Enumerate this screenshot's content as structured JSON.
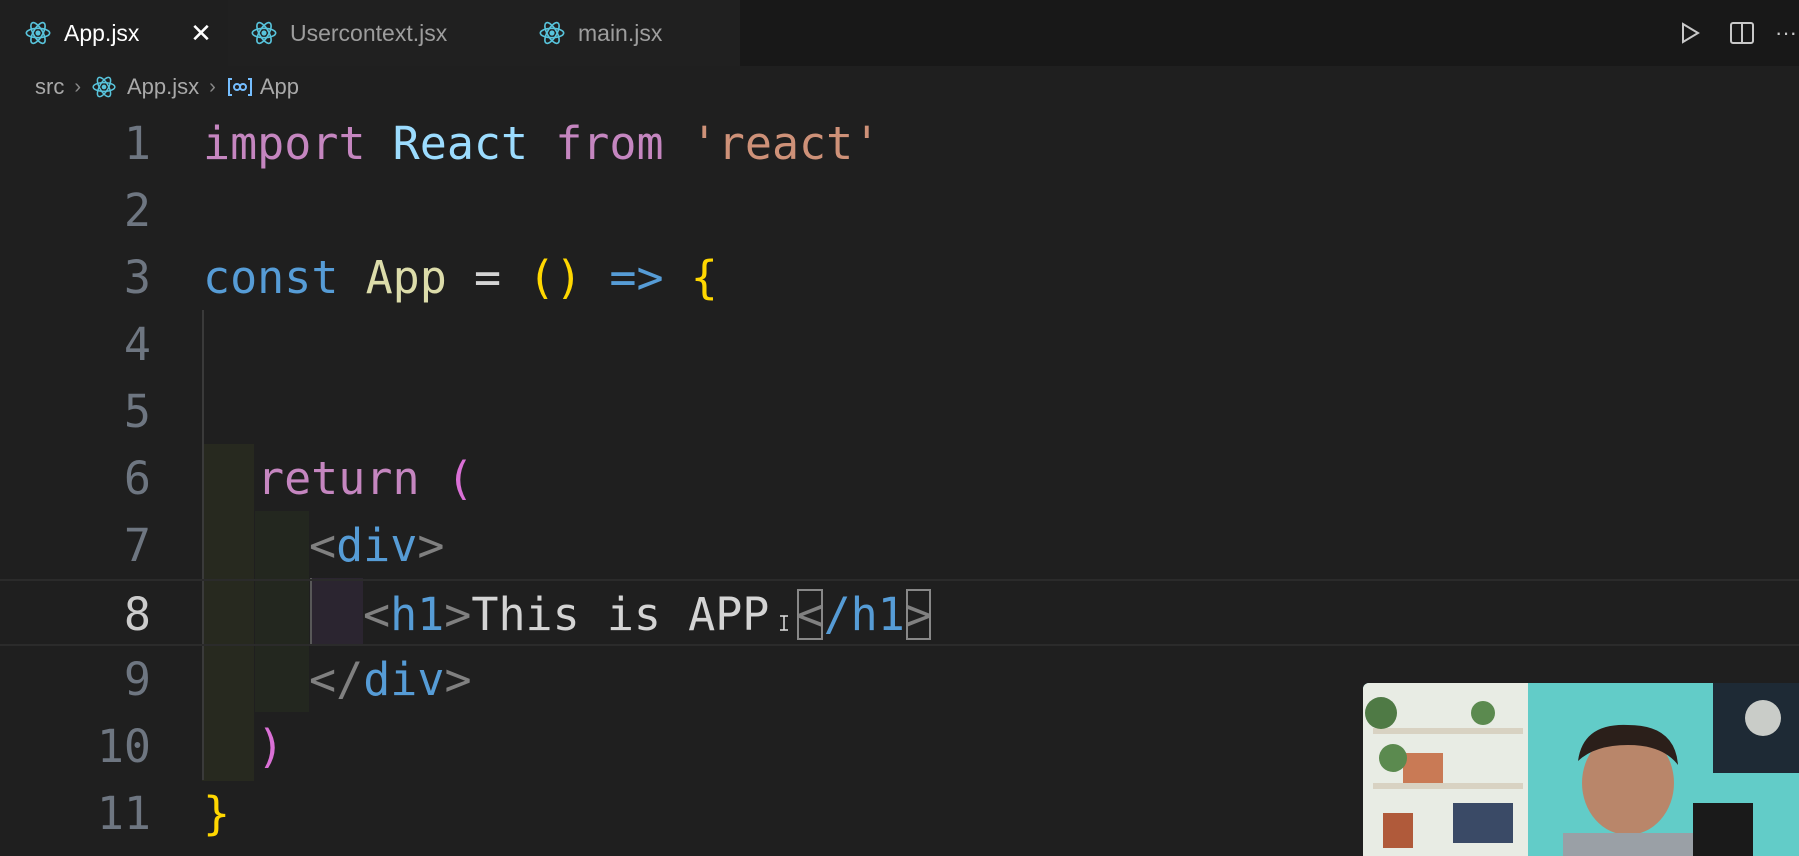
{
  "tabs": [
    {
      "label": "App.jsx",
      "active": true
    },
    {
      "label": "Usercontext.jsx",
      "active": false
    },
    {
      "label": "main.jsx",
      "active": false
    }
  ],
  "tab_close_glyph": "✕",
  "toolbar": {
    "icons": [
      "run-icon",
      "split-editor-icon",
      "more-icon"
    ],
    "more_glyph": "···"
  },
  "breadcrumb": {
    "folder": "src",
    "file": "App.jsx",
    "symbol": "App",
    "separator": "›"
  },
  "editor": {
    "current_line": 8,
    "lines": [
      {
        "number": "1"
      },
      {
        "number": "2"
      },
      {
        "number": "3"
      },
      {
        "number": "4"
      },
      {
        "number": "5"
      },
      {
        "number": "6"
      },
      {
        "number": "7"
      },
      {
        "number": "8"
      },
      {
        "number": "9"
      },
      {
        "number": "10"
      },
      {
        "number": "11"
      }
    ],
    "tokens": {
      "l1_import": "import",
      "l1_react": "React",
      "l1_from": "from",
      "l1_str": "'react'",
      "l3_const": "const",
      "l3_app": "App",
      "l3_eq": "=",
      "l3_parens": "()",
      "l3_arrow": "=>",
      "l3_brace": "{",
      "l6_return": "return",
      "l6_paren": "(",
      "l7_open": "<",
      "l7_div": "div",
      "l7_close": ">",
      "l8_lt": "<",
      "l8_h1": "h1",
      "l8_gt": ">",
      "l8_text": "This is APP",
      "l8_lt2": "<",
      "l8_slash_h1": "/h1",
      "l8_gt2": ">",
      "l9_lt": "</",
      "l9_div": "div",
      "l9_gt": ">",
      "l10_paren": ")",
      "l11_brace": "}"
    }
  },
  "colors": {
    "editor_bg": "#1f1f1f",
    "tabbar_bg": "#181818",
    "keyword_purple": "#c586c0",
    "keyword_blue": "#569cd6",
    "string": "#ce9178",
    "bracket_yellow": "#ffd700",
    "bracket_pink": "#da70d6",
    "react_icon": "#58c4dc"
  }
}
